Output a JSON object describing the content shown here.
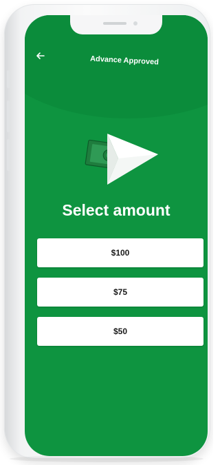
{
  "header": {
    "title": "Advance Approved",
    "back_icon": "arrow-left-icon"
  },
  "illustration": {
    "icon": "paper-plane-money-icon",
    "colors": {
      "plane": "#ffffff",
      "bill": "#1a7a3a",
      "bill_light": "#2f9a55"
    }
  },
  "main": {
    "title": "Select amount",
    "amounts": [
      {
        "label": "$100"
      },
      {
        "label": "$75"
      },
      {
        "label": "$50"
      }
    ]
  },
  "colors": {
    "screen_bg": "#0e9440",
    "button_bg": "#ffffff",
    "text_light": "#ffffff",
    "text_dark": "#1a1a1a"
  }
}
